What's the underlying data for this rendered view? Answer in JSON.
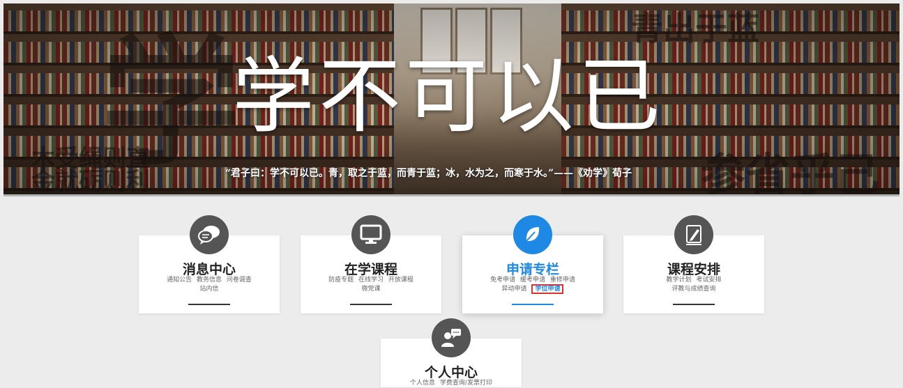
{
  "banner": {
    "title": "学不可以已",
    "quote": "“君子曰：学不可以已。青，取之于蓝，而青于蓝；冰，水为之，而寒于水。”——《劝学》荀子",
    "bg_calligraphy": {
      "left_big": "学",
      "left_bottom_1": "木受绳则直",
      "left_bottom_2": "金就砺则利",
      "right_top": "青出于蓝",
      "right_bottom": "参省乎己"
    }
  },
  "cards": [
    {
      "title": "消息中心",
      "icon": "chat-bubbles-icon",
      "links": [
        "通知公告",
        "教务信息",
        "问卷调查",
        "站内信"
      ]
    },
    {
      "title": "在学课程",
      "icon": "monitor-icon",
      "links": [
        "防疫专题",
        "在线学习",
        "开放课程",
        "微党课"
      ]
    },
    {
      "title": "申请专栏",
      "icon": "leaf-icon",
      "links": [
        "免考申请",
        "缓考申请",
        "重修申请",
        "异动申请",
        "学位申请"
      ],
      "highlighted": "学位申请"
    },
    {
      "title": "课程安排",
      "icon": "pencil-icon",
      "links": [
        "教学计划",
        "考试安排",
        "评教与成绩查询"
      ]
    },
    {
      "title": "个人中心",
      "icon": "user-message-icon",
      "links": [
        "个人信息",
        "学费查询/发票打印"
      ]
    }
  ],
  "colors": {
    "accent": "#1e88e5",
    "highlight_border": "#e0302d",
    "icon_gray": "#555555",
    "page_bg": "#ececec"
  }
}
